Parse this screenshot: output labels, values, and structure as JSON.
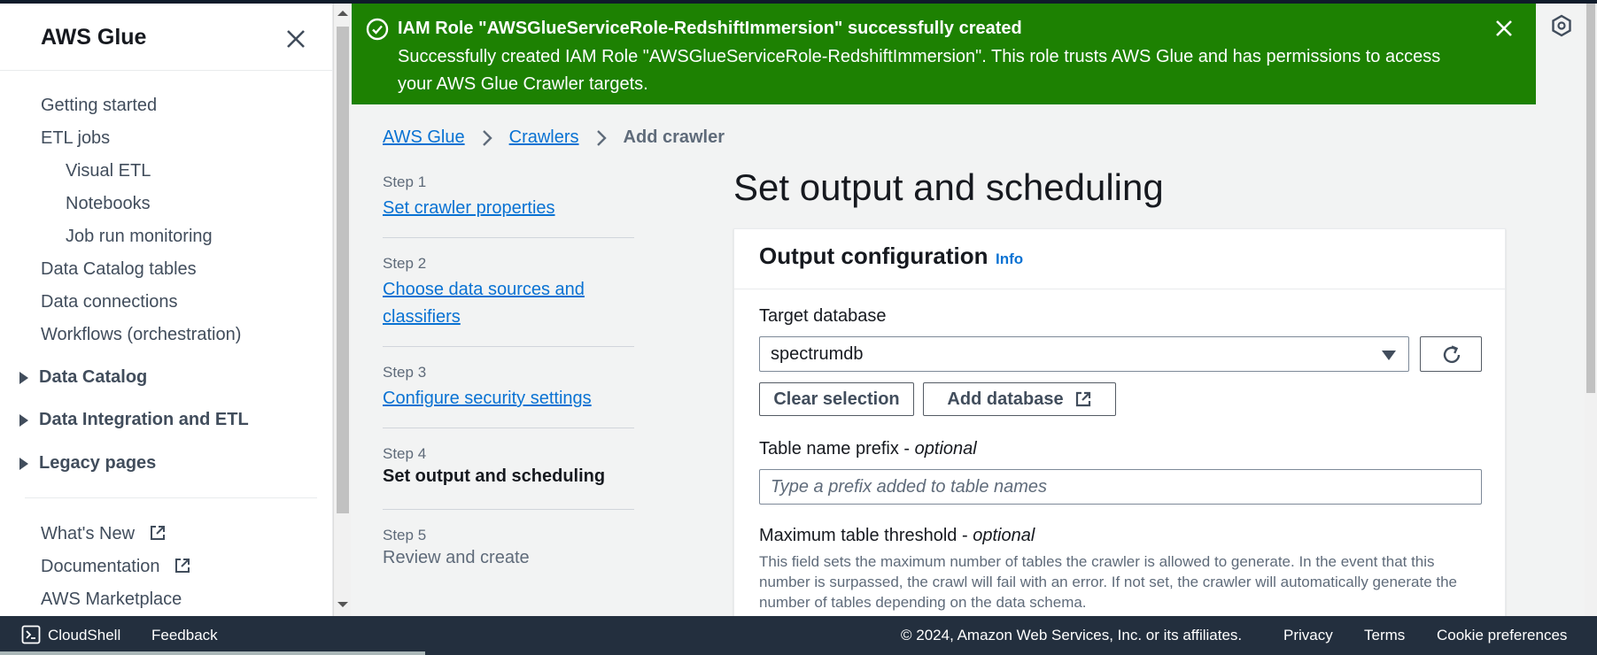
{
  "sidebar": {
    "title": "AWS Glue",
    "items": [
      "Getting started",
      "ETL jobs",
      "Visual ETL",
      "Notebooks",
      "Job run monitoring",
      "Data Catalog tables",
      "Data connections",
      "Workflows (orchestration)"
    ],
    "sections": [
      "Data Catalog",
      "Data Integration and ETL",
      "Legacy pages"
    ],
    "links": {
      "whats_new": "What's New",
      "documentation": "Documentation",
      "marketplace": "AWS Marketplace"
    }
  },
  "flash": {
    "title": "IAM Role \"AWSGlueServiceRole-RedshiftImmersion\" successfully created",
    "message": "Successfully created IAM Role \"AWSGlueServiceRole-RedshiftImmersion\". This role trusts AWS Glue and has permissions to access your AWS Glue Crawler targets.",
    "color": "#1d8102"
  },
  "breadcrumb": {
    "items": [
      "AWS Glue",
      "Crawlers"
    ],
    "current": "Add crawler"
  },
  "steps": [
    {
      "num": "Step 1",
      "label": "Set crawler properties"
    },
    {
      "num": "Step 2",
      "label": "Choose data sources and classifiers"
    },
    {
      "num": "Step 3",
      "label": "Configure security settings"
    },
    {
      "num": "Step 4",
      "label": "Set output and scheduling"
    },
    {
      "num": "Step 5",
      "label": "Review and create"
    }
  ],
  "page": {
    "title": "Set output and scheduling"
  },
  "output_config": {
    "title": "Output configuration",
    "info": "Info",
    "target_db_label": "Target database",
    "target_db_value": "spectrumdb",
    "clear_selection": "Clear selection",
    "add_database": "Add database",
    "prefix_label": "Table name prefix - ",
    "optional": "optional",
    "prefix_placeholder": "Type a prefix added to table names",
    "threshold_label": "Maximum table threshold - ",
    "threshold_desc": "This field sets the maximum number of tables the crawler is allowed to generate. In the event that this number is surpassed, the crawl will fail with an error. If not set, the crawler will automatically generate the number of tables depending on the data schema."
  },
  "footer": {
    "cloudshell": "CloudShell",
    "feedback": "Feedback",
    "copyright": "© 2024, Amazon Web Services, Inc. or its affiliates.",
    "privacy": "Privacy",
    "terms": "Terms",
    "cookies": "Cookie preferences"
  },
  "colors": {
    "link": "#0972d3",
    "footer": "#232f3e",
    "success": "#1d8102"
  }
}
